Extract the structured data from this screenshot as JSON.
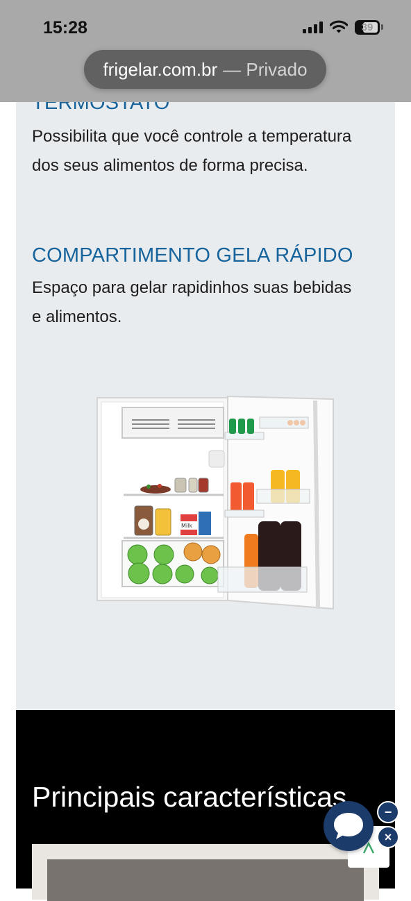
{
  "status_bar": {
    "time": "15:28",
    "battery": "39"
  },
  "browser": {
    "domain": "frigelar.com.br",
    "mode_label": "— Privado"
  },
  "features": [
    {
      "title": "TERMOSTATO",
      "description": "Possibilita que você controle a temperatura dos seus alimentos de forma precisa."
    },
    {
      "title": "COMPARTIMENTO GELA RÁPIDO",
      "description": "Espaço para gelar rapidinhos suas bebidas e alimentos."
    }
  ],
  "product_image": {
    "milk_label": "Milk"
  },
  "main_features": {
    "title": "Principais características"
  },
  "chat_widget": {
    "minimize_symbol": "−",
    "close_symbol": "×"
  },
  "colors": {
    "accent_blue": "#16649b",
    "chat_navy": "#1b3b6b",
    "card_background": "#e9ecef",
    "section_dark": "#000000",
    "scroll_arrow_green": "#3aa66a"
  },
  "icons": {
    "signal": "cellular-signal-icon",
    "wifi": "wifi-icon",
    "battery": "battery-icon",
    "chat": "chat-bubble-icon",
    "scroll_top": "chevron-up-icon"
  }
}
